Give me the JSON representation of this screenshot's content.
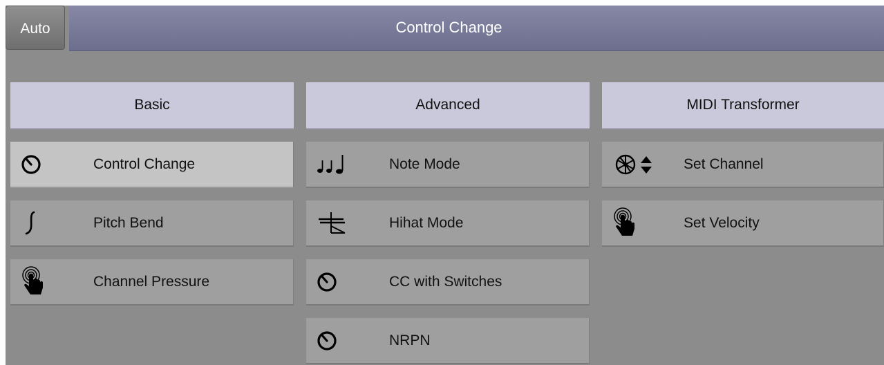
{
  "toolbar": {
    "auto_label": "Auto"
  },
  "title": "Control Change",
  "columns": {
    "basic": {
      "header": "Basic",
      "items": [
        {
          "label": "Control Change",
          "icon": "knob-icon"
        },
        {
          "label": "Pitch Bend",
          "icon": "pitch-bend-icon"
        },
        {
          "label": "Channel Pressure",
          "icon": "touch-pressure-icon"
        }
      ]
    },
    "advanced": {
      "header": "Advanced",
      "items": [
        {
          "label": "Note Mode",
          "icon": "notes-icon"
        },
        {
          "label": "Hihat Mode",
          "icon": "hihat-icon"
        },
        {
          "label": "CC with Switches",
          "icon": "knob-icon"
        },
        {
          "label": "NRPN",
          "icon": "knob-icon"
        }
      ]
    },
    "midi": {
      "header": "MIDI Transformer",
      "items": [
        {
          "label": "Set Channel",
          "icon": "channel-select-icon"
        },
        {
          "label": "Set Velocity",
          "icon": "touch-pressure-icon"
        }
      ]
    }
  },
  "colors": {
    "background": "#8c8c8c",
    "title_bar": "#7a7b99",
    "header": "#c9c9db",
    "item": "#9f9f9f",
    "item_active": "#c4c4c4"
  }
}
